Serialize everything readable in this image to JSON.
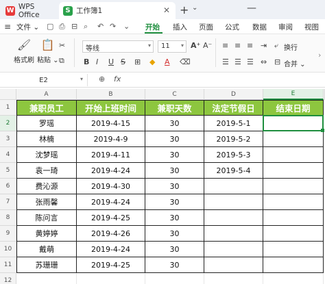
{
  "titlebar": {
    "app_tab": "WPS Office",
    "workbook_tab": "工作簿1",
    "close_glyph": "✕",
    "new_tab_glyph": "+",
    "more_glyph": "⌄",
    "minimize_glyph": "—"
  },
  "menubar": {
    "hamburger": "≡",
    "file": "文件 ⌄",
    "tabs": [
      "开始",
      "插入",
      "页面",
      "公式",
      "数据",
      "审阅",
      "视图"
    ],
    "active_tab": "开始"
  },
  "ribbon": {
    "format_painter": "格式刷",
    "paste": "粘贴 ⌄",
    "font_name": "等线",
    "font_size": "11",
    "bold": "B",
    "italic": "I",
    "underline": "U",
    "strike": "S",
    "font_color": "A",
    "wrap": "换行",
    "merge": "合并 ⌄"
  },
  "formulabar": {
    "namebox": "E2",
    "fx": "fx"
  },
  "grid": {
    "columns": [
      "A",
      "B",
      "C",
      "D",
      "E"
    ],
    "rows": [
      "1",
      "2",
      "3",
      "4",
      "5",
      "6",
      "7",
      "8",
      "9",
      "10",
      "11",
      "12"
    ],
    "selected_cell": "E2",
    "headers": [
      "兼职员工",
      "开始上班时间",
      "兼职天数",
      "法定节假日",
      "结束日期"
    ],
    "data": [
      [
        "罗瑶",
        "2019-4-15",
        "30",
        "2019-5-1",
        ""
      ],
      [
        "林楠",
        "2019-4-9",
        "30",
        "2019-5-2",
        ""
      ],
      [
        "沈梦瑶",
        "2019-4-11",
        "30",
        "2019-5-3",
        ""
      ],
      [
        "袁一琦",
        "2019-4-24",
        "30",
        "2019-5-4",
        ""
      ],
      [
        "费沁源",
        "2019-4-30",
        "30",
        "",
        ""
      ],
      [
        "张雨馨",
        "2019-4-24",
        "30",
        "",
        ""
      ],
      [
        "陈问言",
        "2019-4-25",
        "30",
        "",
        ""
      ],
      [
        "黄婷婷",
        "2019-4-26",
        "30",
        "",
        ""
      ],
      [
        "戴萌",
        "2019-4-24",
        "30",
        "",
        ""
      ],
      [
        "苏珊珊",
        "2019-4-25",
        "30",
        "",
        ""
      ]
    ]
  },
  "colors": {
    "accent": "#1e8e3e",
    "header_fill": "#8dc63f"
  }
}
